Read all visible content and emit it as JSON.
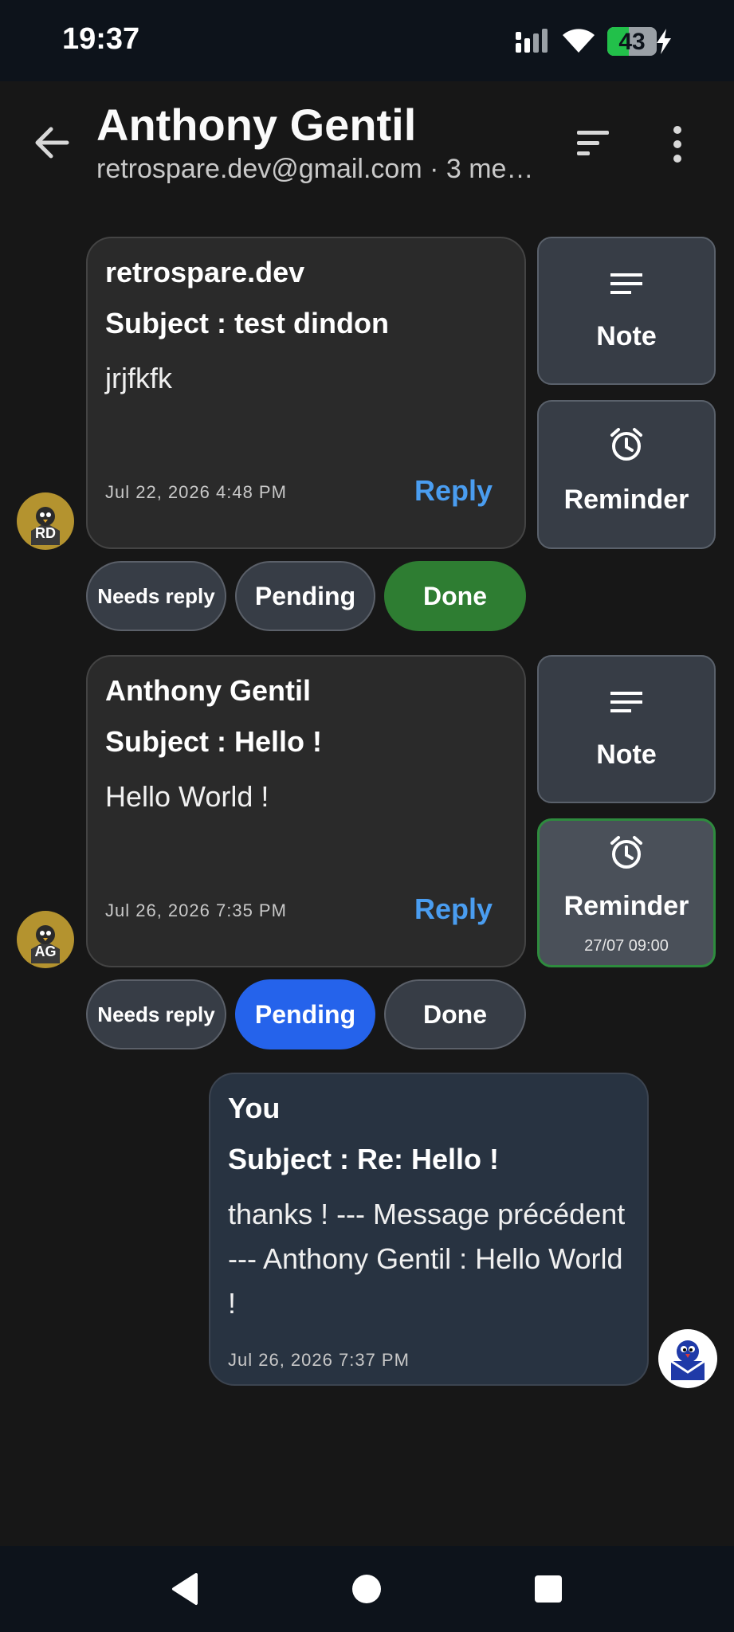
{
  "status_bar": {
    "time": "19:37",
    "battery": {
      "level_text": "43",
      "level_percent": 43
    },
    "icons": [
      "signal-icon",
      "wifi-icon",
      "battery-icon",
      "charging-bolt-icon"
    ]
  },
  "header": {
    "title": "Anthony Gentil",
    "subtitle": "retrospare.dev@gmail.com · 3 me…",
    "icons": [
      "back-arrow-icon",
      "sort-icon",
      "more-vert-icon"
    ]
  },
  "messages": [
    {
      "sender": "retrospare.dev",
      "subject": "Subject : test dindon",
      "body": "jrjfkfk",
      "date": "Jul 22, 2026 4:48 PM",
      "reply_label": "Reply",
      "avatar_initials": "RD",
      "note_label": "Note",
      "reminder_label": "Reminder",
      "reminder_time": "",
      "statuses": [
        "Needs reply",
        "Pending",
        "Done"
      ],
      "active_status": "Done"
    },
    {
      "sender": "Anthony Gentil",
      "subject": "Subject : Hello !",
      "body": "Hello World !",
      "date": "Jul 26, 2026 7:35 PM",
      "reply_label": "Reply",
      "avatar_initials": "AG",
      "note_label": "Note",
      "reminder_label": "Reminder",
      "reminder_time": "27/07 09:00",
      "statuses": [
        "Needs reply",
        "Pending",
        "Done"
      ],
      "active_status": "Pending"
    },
    {
      "sender": "You",
      "subject": "Subject : Re: Hello !",
      "body": "thanks ! --- Message précédent --- Anthony Gentil : Hello World !",
      "date": "Jul 26, 2026 7:37 PM"
    }
  ],
  "colors": {
    "background": "#171717",
    "card": "#2a2a2a",
    "card_you": "#283341",
    "reply_link": "#4a9df0",
    "done_active": "#2e7d32",
    "pending_active": "#2563eb",
    "avatar_gold": "#b4932f"
  },
  "nav_bar": {
    "icons": [
      "nav-back-icon",
      "nav-home-icon",
      "nav-recents-icon"
    ]
  }
}
